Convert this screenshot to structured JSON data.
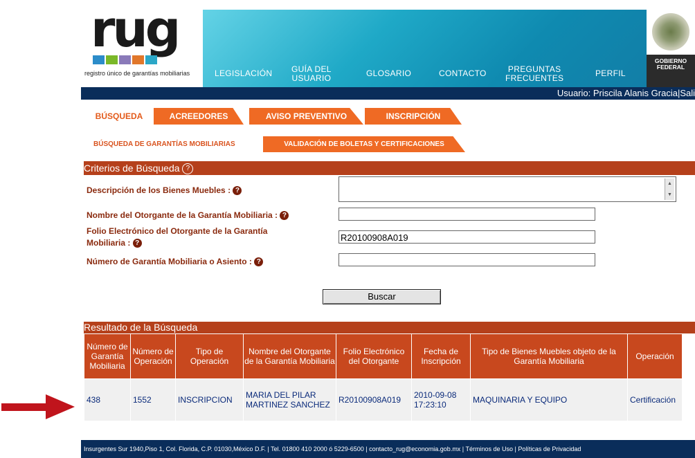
{
  "logo": {
    "text": "rug",
    "subtitle": "registro único de garantías mobiliarias",
    "squares": [
      "#2c8cc9",
      "#7ab829",
      "#8a7ab9",
      "#e1772a",
      "#2ba7c7"
    ]
  },
  "nav": {
    "items": [
      "LEGISLACIÓN",
      "GUÍA DEL\nUSUARIO",
      "GLOSARIO",
      "CONTACTO",
      "PREGUNTAS\nFRECUENTES",
      "PERFIL"
    ]
  },
  "gobierno": {
    "line1": "GOBIERNO",
    "line2": "FEDERAL"
  },
  "userbar": {
    "text": "Usuario: Priscila Alanis Gracia|Sali"
  },
  "tabs": {
    "busqueda": "BÚSQUEDA",
    "acreedores": "ACREEDORES",
    "aviso": "AVISO PREVENTIVO",
    "inscripcion": "INSCRIPCIÓN"
  },
  "subtabs": {
    "garantias": "BÚSQUEDA DE GARANTÍAS MOBILIARIAS",
    "validacion": "VALIDACIÓN DE BOLETAS Y CERTIFICACIONES"
  },
  "criteria": {
    "title": "Criterios de Búsqueda",
    "descripcion_label": "Descripción de los Bienes Muebles :",
    "nombre_label": "Nombre del Otorgante de la Garantía Mobiliaria :",
    "folio_label_1": "Folio Electrónico del Otorgante de la Garantía",
    "folio_label_2": "Mobiliaria :",
    "numero_label": "Número de Garantía Mobiliaria o Asiento :",
    "folio_value": "R20100908A019",
    "search_button": "Buscar"
  },
  "results": {
    "title": "Resultado de la Búsqueda",
    "headers": [
      "Número de Garantía Mobiliaria",
      "Número de Operación",
      "Tipo de Operación",
      "Nombre del Otorgante de la Garantía Mobiliaria",
      "Folio Electrónico del Otorgante",
      "Fecha de Inscripción",
      "Tipo de Bienes Muebles objeto de la Garantía Mobiliaria",
      "Operación"
    ],
    "rows": [
      [
        "438",
        "1552",
        "INSCRIPCION",
        "MARIA DEL PILAR MARTINEZ SANCHEZ",
        "R20100908A019",
        "2010-09-08 17:23:10",
        "MAQUINARIA Y EQUIPO",
        "Certificación"
      ]
    ]
  },
  "footer": {
    "text": "Insurgentes Sur 1940,Piso 1, Col. Florida, C.P. 01030,México D.F. | Tel. 01800 410 2000 ó 5229-6500 | contacto_rug@economia.gob.mx | Términos de Uso | Políticas de Privacidad"
  },
  "colors": {
    "accent": "#ef6a24",
    "section": "#b5401b",
    "navy": "#0a2d5a",
    "arrow": "#c0141c"
  }
}
